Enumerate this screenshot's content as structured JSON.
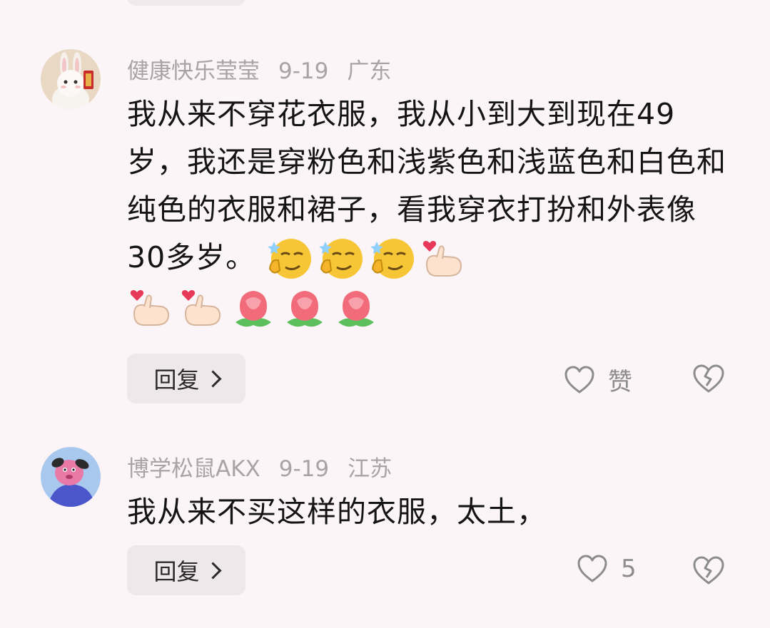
{
  "comments": [
    {
      "username": "健康快乐莹莹",
      "date": "9-19",
      "location": "广东",
      "text": "我从来不穿花衣服，我从小到大到现在49岁，我还是穿粉色和浅紫色和浅蓝色和白色和纯色的衣服和裙子，看我穿衣打扮和外表像30多岁。",
      "emojis": [
        "smirk-thumb",
        "smirk-thumb",
        "smirk-thumb",
        "finger-heart",
        "finger-heart",
        "finger-heart",
        "rose",
        "rose",
        "rose"
      ],
      "reply_label": "回复",
      "like_label": "赞"
    },
    {
      "username": "博学松鼠AKX",
      "date": "9-19",
      "location": "江苏",
      "text": "我从来不买这样的衣服，太土，",
      "reply_label": "回复",
      "like_count": "5"
    }
  ],
  "colors": {
    "background": "#fcf5f8",
    "meta": "#a9a3a6",
    "text": "#141414",
    "button_bg": "#efe8eb"
  }
}
